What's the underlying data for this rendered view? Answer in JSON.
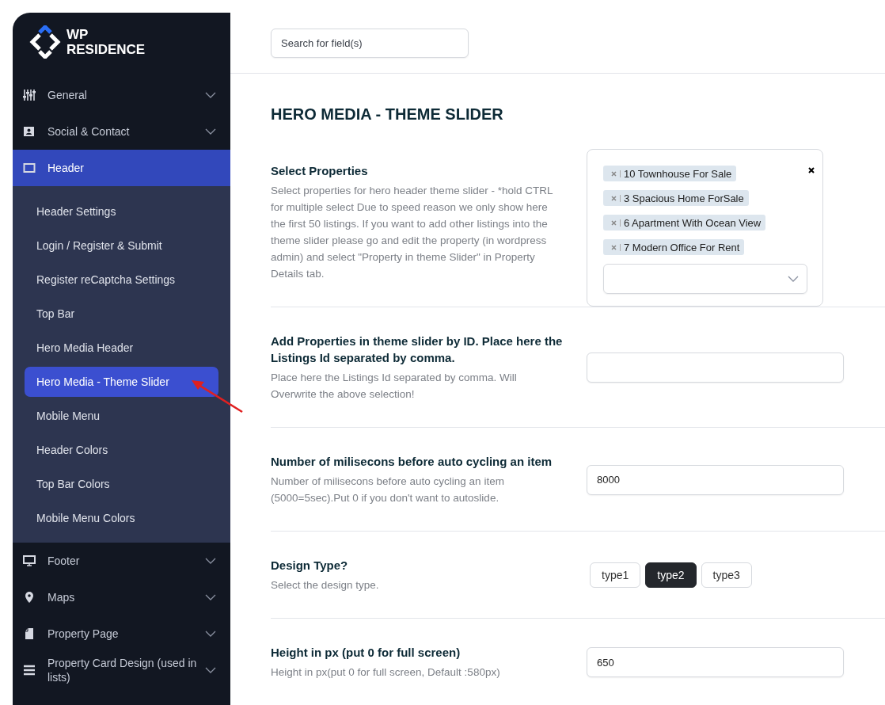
{
  "logo": {
    "line1": "WP",
    "line2": "RESIDENCE"
  },
  "sidebar": {
    "items": [
      {
        "label": "General",
        "expanded": false,
        "selected": false
      },
      {
        "label": "Social & Contact",
        "expanded": false,
        "selected": false
      },
      {
        "label": "Header",
        "expanded": true,
        "selected": true,
        "children": [
          {
            "label": "Header Settings",
            "selected": false
          },
          {
            "label": "Login / Register & Submit",
            "selected": false
          },
          {
            "label": "Register reCaptcha Settings",
            "selected": false
          },
          {
            "label": "Top Bar",
            "selected": false
          },
          {
            "label": "Hero Media Header",
            "selected": false
          },
          {
            "label": "Hero Media - Theme Slider",
            "selected": true
          },
          {
            "label": "Mobile Menu",
            "selected": false
          },
          {
            "label": "Header Colors",
            "selected": false
          },
          {
            "label": "Top Bar Colors",
            "selected": false
          },
          {
            "label": "Mobile Menu Colors",
            "selected": false
          }
        ]
      },
      {
        "label": "Footer",
        "expanded": false,
        "selected": false
      },
      {
        "label": "Maps",
        "expanded": false,
        "selected": false
      },
      {
        "label": "Property Page",
        "expanded": false,
        "selected": false
      },
      {
        "label": "Property Card Design (used in lists)",
        "expanded": false,
        "selected": false
      }
    ]
  },
  "search": {
    "placeholder": "Search for field(s)"
  },
  "page_title": "HERO MEDIA - THEME SLIDER",
  "fields": [
    {
      "kind": "multiselect",
      "label": "Select Properties",
      "description": "Select properties for hero header theme slider - *hold CTRL for multiple select Due to speed reason we only show here the first 50 listings. If you want to add other listings into the theme slider please go and edit the property (in wordpress admin) and select \"Property in theme Slider\" in Property Details tab.",
      "tags": [
        "10 Townhouse For Sale",
        "3 Spacious Home ForSale",
        "6 Apartment With Ocean View",
        "7 Modern Office For Rent"
      ]
    },
    {
      "kind": "text",
      "label": "Add Properties in theme slider by ID. Place here the Listings Id separated by comma.",
      "description": "Place here the Listings Id separated by comma. Will Overwrite the above selection!"
    },
    {
      "kind": "text",
      "label": "Number of milisecons before auto cycling an item",
      "description": "Number of milisecons before auto cycling an item (5000=5sec).Put 0 if you don't want to autoslide.",
      "value": "8000"
    },
    {
      "kind": "segmented",
      "label": "Design Type?",
      "description": "Select the design type.",
      "options": [
        {
          "label": "type1",
          "selected": false
        },
        {
          "label": "type2",
          "selected": true
        },
        {
          "label": "type3",
          "selected": false
        }
      ]
    },
    {
      "kind": "text",
      "label": "Height in px (put 0 for full screen)",
      "description": "Height in px(put 0 for full screen, Default :580px)",
      "value": "650"
    }
  ]
}
